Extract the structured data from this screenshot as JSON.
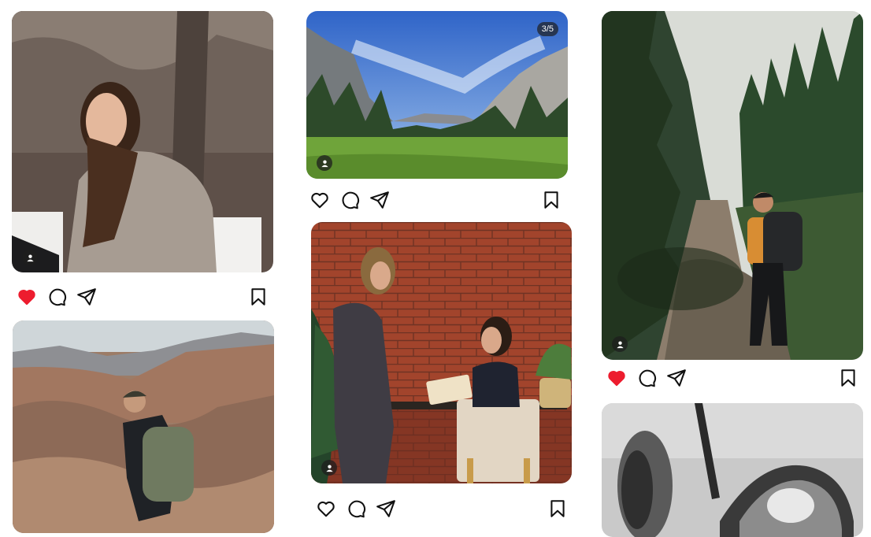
{
  "colors": {
    "like_active": "#ed1c2e",
    "icon_stroke": "#111111",
    "badge_bg": "#1e1e1e"
  },
  "posts": [
    {
      "id": "p1",
      "liked": true,
      "icons": [
        "heart-icon",
        "comment-icon",
        "share-icon",
        "bookmark-icon"
      ]
    },
    {
      "id": "p2",
      "counter": "3/5",
      "liked": false,
      "icons": [
        "heart-icon",
        "comment-icon",
        "share-icon",
        "bookmark-icon"
      ]
    },
    {
      "id": "p3",
      "liked": false,
      "icons": [
        "heart-icon",
        "comment-icon",
        "share-icon",
        "bookmark-icon"
      ]
    },
    {
      "id": "p4",
      "liked": true,
      "icons": [
        "heart-icon",
        "comment-icon",
        "share-icon",
        "bookmark-icon"
      ]
    },
    {
      "id": "p5",
      "liked": false
    },
    {
      "id": "p6",
      "liked": false
    }
  ]
}
